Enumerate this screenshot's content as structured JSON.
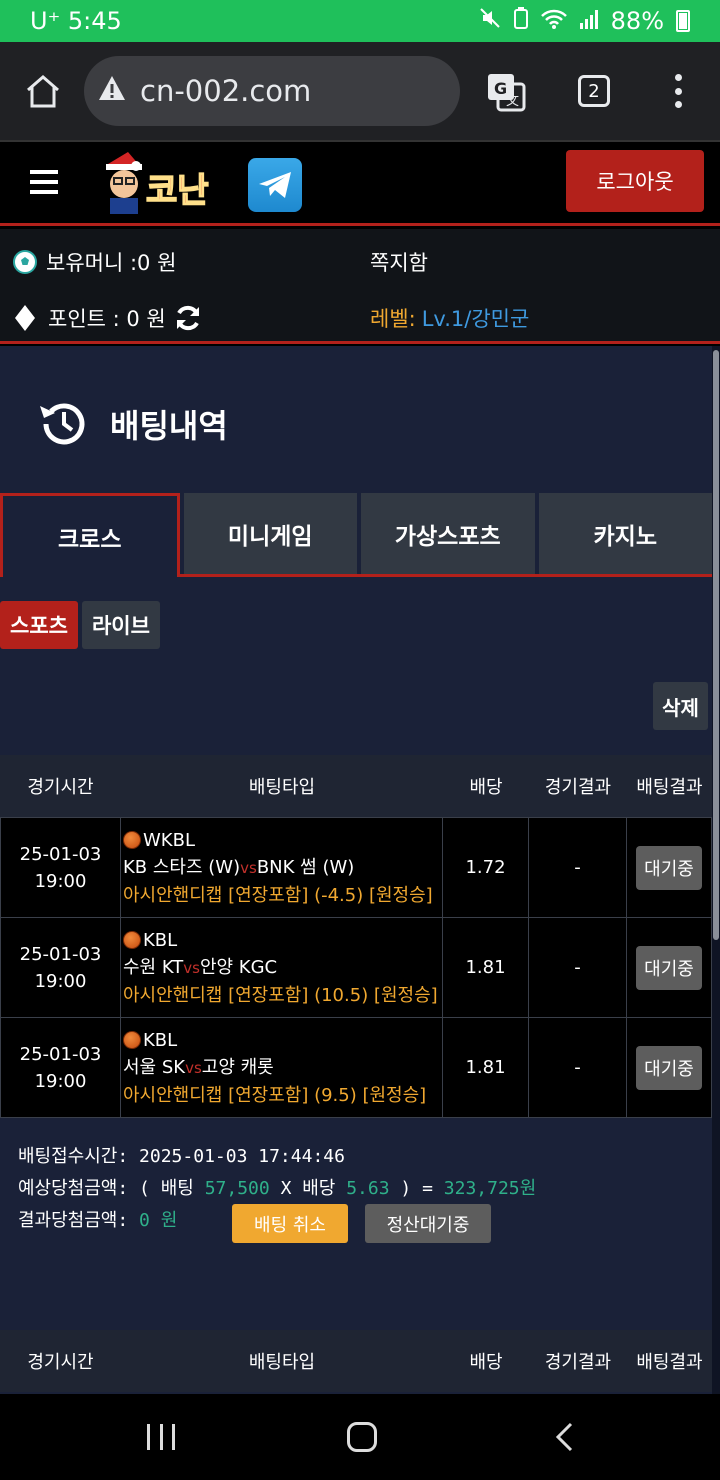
{
  "status_bar": {
    "carrier_time": "U⁺ 5:45",
    "battery": "88%"
  },
  "browser": {
    "url": "cn-002.com",
    "tab_count": "2"
  },
  "header": {
    "logo_text": "코난",
    "logout_label": "로그아웃"
  },
  "account": {
    "money_label": "보유머니 :0 원",
    "messages_label": "쪽지함",
    "points_label": "포인트 :  0 원",
    "level_label": "레벨:",
    "level_value": "Lv.1/강민군"
  },
  "page": {
    "title": "배팅내역"
  },
  "category_tabs": [
    {
      "label": "크로스",
      "active": true
    },
    {
      "label": "미니게임",
      "active": false
    },
    {
      "label": "가상스포츠",
      "active": false
    },
    {
      "label": "카지노",
      "active": false
    }
  ],
  "sub_tabs": [
    {
      "label": "스포츠",
      "active": true
    },
    {
      "label": "라이브",
      "active": false
    }
  ],
  "delete_label": "삭제",
  "table_headers": [
    "경기시간",
    "배팅타입",
    "배당",
    "경기결과",
    "배팅결과"
  ],
  "bets": [
    {
      "date": "25-01-03",
      "time": "19:00",
      "league": "WKBL",
      "home": "KB 스타즈 (W)",
      "vs": "vs",
      "away": "BNK 썸 (W)",
      "market": "아시안핸디캡 [연장포함] (-4.5) [원정승]",
      "odds": "1.72",
      "result": "-",
      "status": "대기중"
    },
    {
      "date": "25-01-03",
      "time": "19:00",
      "league": "KBL",
      "home": "수원 KT",
      "vs": "vs",
      "away": "안양 KGC",
      "market": "아시안핸디캡 [연장포함] (10.5) [원정승]",
      "odds": "1.81",
      "result": "-",
      "status": "대기중"
    },
    {
      "date": "25-01-03",
      "time": "19:00",
      "league": "KBL",
      "home": "서울 SK",
      "vs": "vs",
      "away": "고양 캐롯",
      "market": "아시안핸디캡 [연장포함] (9.5) [원정승]",
      "odds": "1.81",
      "result": "-",
      "status": "대기중"
    }
  ],
  "summary": {
    "received_label": "배팅접수시간:",
    "received_value": "2025-01-03 17:44:46",
    "expected_label": "예상당첨금액:",
    "bet_open": "( 배팅",
    "bet_amount": "57,500",
    "times": "X 배당",
    "total_odds": "5.63",
    "equals": ") =",
    "expected_payout": "323,725원",
    "result_label": "결과당첨금액:",
    "result_value": "0",
    "result_unit": "원",
    "cancel_label": "배팅 취소",
    "pending_label": "정산대기중"
  },
  "colors": {
    "accent_red": "#b3211b",
    "orange": "#f0a830",
    "green": "#2fb08a",
    "link_blue": "#3f9ae0"
  }
}
